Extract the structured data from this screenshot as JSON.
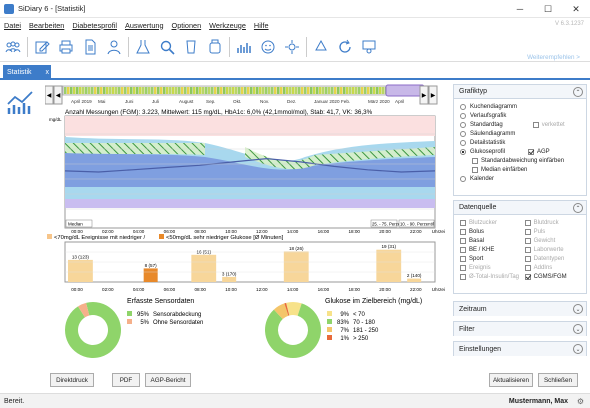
{
  "window": {
    "title": "SiDiary 6 - [Statistik]",
    "version": "V 6.3.1237",
    "minimize": "─",
    "maximize": "☐",
    "close": "✕"
  },
  "menu": [
    "Datei",
    "Bearbeiten",
    "Diabetesprofil",
    "Auswertung",
    "Optionen",
    "Werkzeuge",
    "Hilfe"
  ],
  "toolbar": {
    "help_link": "Weiterempfehlen >"
  },
  "tab": {
    "label": "Statistik",
    "close": "x"
  },
  "scrubber": {
    "months": [
      "April 2019",
      "Mai",
      "Juni",
      "Juli",
      "August",
      "Sep.",
      "Okt.",
      "Nov.",
      "Dez.",
      "Januar 2020",
      "Feb.",
      "März 2020",
      "April"
    ]
  },
  "chart_data": [
    {
      "type": "area",
      "title": "Anzahl Messungen (FGM): 3.223, Mittelwert: 115 mg/dL, HbA1c: 6,0% (42,1mmol/mol), Stab: 41,7, VK: 36,3%",
      "ylabel": "mg/dL",
      "x": [
        "00:00",
        "02:00",
        "04:00",
        "06:00",
        "08:00",
        "10:00",
        "12:00",
        "14:00",
        "16:00",
        "18:00",
        "20:00",
        "22:00",
        "Uhrzeit"
      ],
      "legend": [
        "Median",
        "25. - 75. Perzentil",
        "10. - 90. Perzentil"
      ],
      "colors": {
        "p10_90": "#a8d8ee",
        "p25_75": "#6a8fd4",
        "median": "#4a5fa8",
        "target_low": "#9a7bd6",
        "hatch": "#2f8f2f",
        "hyper": "#f4a0a0"
      },
      "series": [
        {
          "name": "Median",
          "values": [
            102,
            100,
            104,
            108,
            112,
            118,
            124,
            118,
            110,
            104,
            100,
            102
          ]
        }
      ]
    },
    {
      "type": "bar",
      "legend": [
        "<70mg/dL Ereignisse mit niedriger /",
        "<50mg/dL sehr niedriger Glukose [Ø Minuten]"
      ],
      "x": [
        "00:00",
        "02:00",
        "04:00",
        "06:00",
        "08:00",
        "10:00",
        "12:00",
        "14:00",
        "16:00",
        "18:00",
        "20:00",
        "22:00",
        "Uhrzeit"
      ],
      "labels": [
        "13 (123)",
        "8 (57)",
        "16 (51)",
        "3 (170)",
        "18 (26)",
        "19 (31)",
        "2 (140)"
      ],
      "values": [
        13,
        8,
        16,
        3,
        18,
        19,
        2
      ],
      "colors": {
        "low": "#f7c58a",
        "very_low": "#e8892a"
      }
    },
    {
      "type": "pie",
      "title": "Erfasste Sensordaten",
      "series": [
        {
          "name": "Sensorabdeckung",
          "value": 95,
          "color": "#8fd46a",
          "label": "95%"
        },
        {
          "name": "Ohne Sensordaten",
          "value": 5,
          "color": "#f5b08a",
          "label": "5%"
        }
      ]
    },
    {
      "type": "pie",
      "title": "Glukose im Zielbereich (mg/dL)",
      "series": [
        {
          "name": "< 70",
          "value": 9,
          "color": "#f7e28a",
          "label": "9%"
        },
        {
          "name": "70 - 180",
          "value": 83,
          "color": "#8fd46a",
          "label": "83%"
        },
        {
          "name": "181 - 250",
          "value": 7,
          "color": "#f4c56a",
          "label": "7%"
        },
        {
          "name": "> 250",
          "value": 1,
          "color": "#e86a3a",
          "label": "1%"
        }
      ]
    }
  ],
  "panels": {
    "grafiktyp": {
      "title": "Grafiktyp",
      "options": [
        "Kuchendiagramm",
        "Verlaufsgrafik",
        "Standardtag",
        "Säulendiagramm",
        "Detailstatistik",
        "Glukoseprofil",
        "Kalender"
      ],
      "selected": "Glukoseprofil",
      "verkettet": "verkettet",
      "agp": "AGP",
      "std": "Standardabweichung einfärben",
      "median": "Median einfärben"
    },
    "datenquelle": {
      "title": "Datenquelle",
      "left": [
        "Blutzucker",
        "Bolus",
        "Basal",
        "BE / KHE",
        "Sport",
        "Ereignis",
        "Ø-Total-Insulin/Tag"
      ],
      "right": [
        "Blutdruck",
        "Puls",
        "Gewicht",
        "Laborwerte",
        "Datentypen",
        "AddIns",
        "CGMS/FGM"
      ],
      "checked": [
        "CGMS/FGM"
      ]
    },
    "zeitraum": "Zeitraum",
    "filter": "Filter",
    "einstellungen": "Einstellungen"
  },
  "footer": {
    "direktdruck": "Direktdruck",
    "pdf": "PDF",
    "agp": "AGP-Bericht",
    "aktualisieren": "Aktualisieren",
    "schliessen": "Schließen"
  },
  "status": {
    "text": "Bereit.",
    "user": "Mustermann, Max"
  }
}
